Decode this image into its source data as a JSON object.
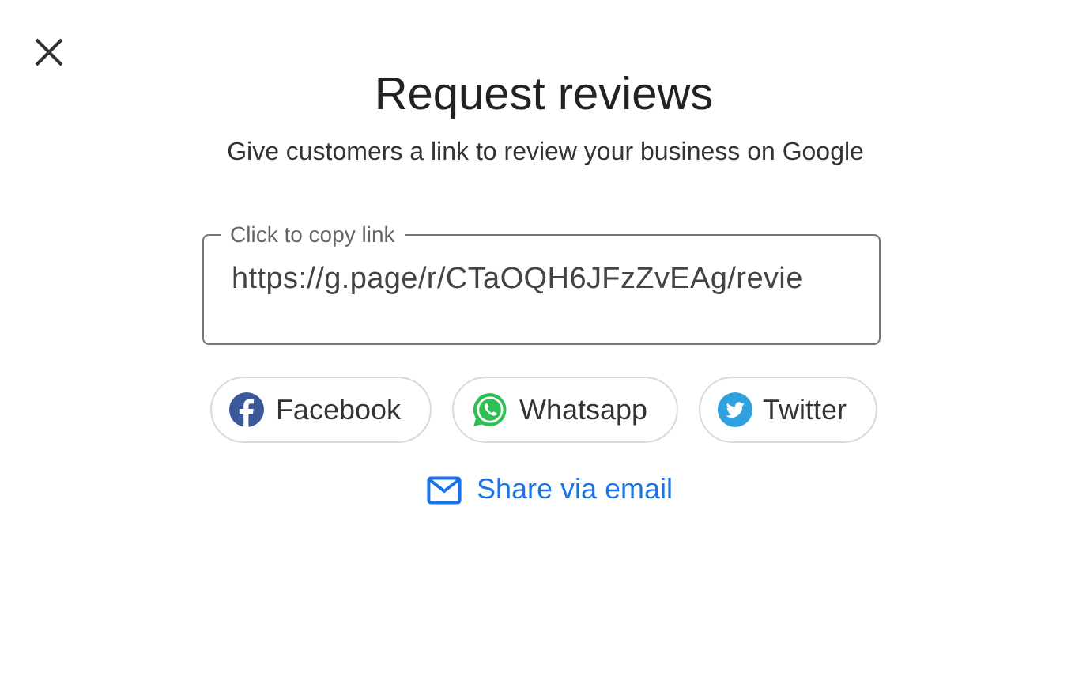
{
  "dialog": {
    "title": "Request reviews",
    "subtitle": "Give customers a link to review your business on Google"
  },
  "link_field": {
    "label": "Click to copy link",
    "value": "https://g.page/r/CTaOQH6JFzZvEAg/revie"
  },
  "share_buttons": [
    {
      "kind": "facebook",
      "label": "Facebook"
    },
    {
      "kind": "whatsapp",
      "label": "Whatsapp"
    },
    {
      "kind": "twitter",
      "label": "Twitter"
    }
  ],
  "email_link": {
    "label": "Share via email"
  }
}
